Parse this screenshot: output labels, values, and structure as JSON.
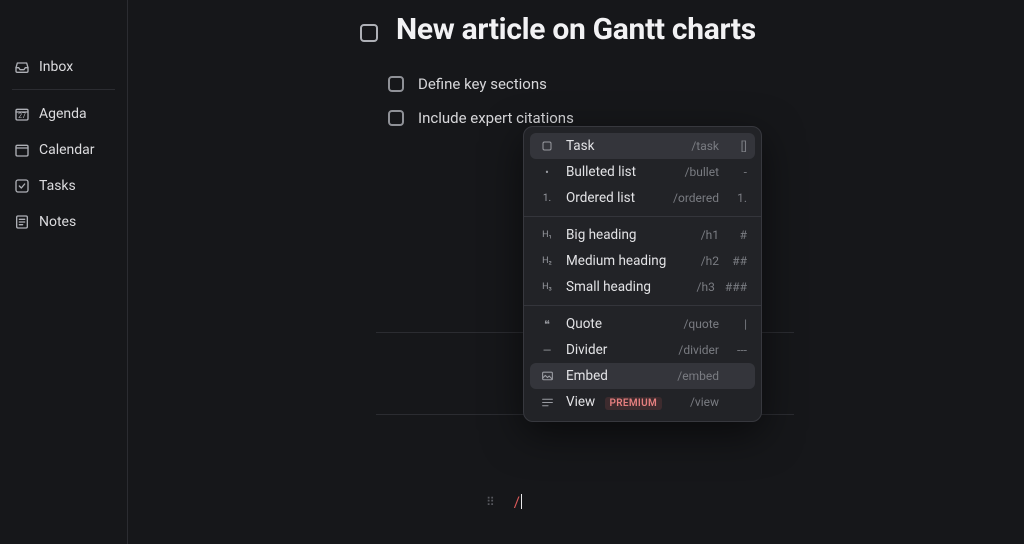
{
  "sidebar": {
    "items": [
      {
        "id": "inbox",
        "label": "Inbox"
      },
      {
        "id": "agenda",
        "label": "Agenda"
      },
      {
        "id": "calendar",
        "label": "Calendar"
      },
      {
        "id": "tasks",
        "label": "Tasks"
      },
      {
        "id": "notes",
        "label": "Notes"
      }
    ],
    "calendar_day": "27"
  },
  "document": {
    "title": "New article on Gantt charts",
    "tasks": [
      "Define key sections",
      "Include expert citations"
    ],
    "slash_trigger": "/"
  },
  "slash_menu": {
    "groups": [
      [
        {
          "label": "Task",
          "command": "/task",
          "shortcut": "[]",
          "icon": "checkbox",
          "hl": true
        },
        {
          "label": "Bulleted list",
          "command": "/bullet",
          "shortcut": "-",
          "icon": "bullet",
          "hl": false
        },
        {
          "label": "Ordered list",
          "command": "/ordered",
          "shortcut": "1.",
          "icon": "ordered",
          "hl": false
        }
      ],
      [
        {
          "label": "Big heading",
          "command": "/h1",
          "shortcut": "#",
          "icon": "h1",
          "hl": false
        },
        {
          "label": "Medium heading",
          "command": "/h2",
          "shortcut": "##",
          "icon": "h2",
          "hl": false
        },
        {
          "label": "Small heading",
          "command": "/h3",
          "shortcut": "###",
          "icon": "h3",
          "hl": false
        }
      ],
      [
        {
          "label": "Quote",
          "command": "/quote",
          "shortcut": "|",
          "icon": "quote",
          "hl": false
        },
        {
          "label": "Divider",
          "command": "/divider",
          "shortcut": "---",
          "icon": "divider",
          "hl": false
        },
        {
          "label": "Embed",
          "command": "/embed",
          "shortcut": "",
          "icon": "embed",
          "hl": true
        },
        {
          "label": "View",
          "command": "/view",
          "shortcut": "",
          "icon": "view",
          "hl": false,
          "badge": "PREMIUM"
        }
      ]
    ]
  }
}
